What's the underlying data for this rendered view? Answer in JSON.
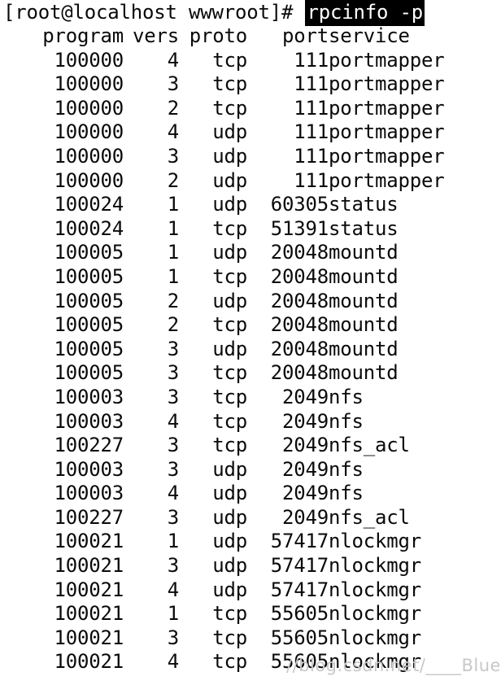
{
  "terminal": {
    "background_color": "#ffffff",
    "foreground_color": "#0a0a0a",
    "highlight_background": "#000000",
    "highlight_foreground": "#ffffff"
  },
  "prompt": {
    "text": "[root@localhost wwwroot]# ",
    "command": "rpcinfo -p"
  },
  "table": {
    "headers": {
      "program": "program",
      "vers": "vers",
      "proto": "proto",
      "port": "port",
      "service": "service"
    },
    "rows": [
      {
        "program": "100000",
        "vers": "4",
        "proto": "tcp",
        "port": "111",
        "service": "portmapper"
      },
      {
        "program": "100000",
        "vers": "3",
        "proto": "tcp",
        "port": "111",
        "service": "portmapper"
      },
      {
        "program": "100000",
        "vers": "2",
        "proto": "tcp",
        "port": "111",
        "service": "portmapper"
      },
      {
        "program": "100000",
        "vers": "4",
        "proto": "udp",
        "port": "111",
        "service": "portmapper"
      },
      {
        "program": "100000",
        "vers": "3",
        "proto": "udp",
        "port": "111",
        "service": "portmapper"
      },
      {
        "program": "100000",
        "vers": "2",
        "proto": "udp",
        "port": "111",
        "service": "portmapper"
      },
      {
        "program": "100024",
        "vers": "1",
        "proto": "udp",
        "port": "60305",
        "service": "status"
      },
      {
        "program": "100024",
        "vers": "1",
        "proto": "tcp",
        "port": "51391",
        "service": "status"
      },
      {
        "program": "100005",
        "vers": "1",
        "proto": "udp",
        "port": "20048",
        "service": "mountd"
      },
      {
        "program": "100005",
        "vers": "1",
        "proto": "tcp",
        "port": "20048",
        "service": "mountd"
      },
      {
        "program": "100005",
        "vers": "2",
        "proto": "udp",
        "port": "20048",
        "service": "mountd"
      },
      {
        "program": "100005",
        "vers": "2",
        "proto": "tcp",
        "port": "20048",
        "service": "mountd"
      },
      {
        "program": "100005",
        "vers": "3",
        "proto": "udp",
        "port": "20048",
        "service": "mountd"
      },
      {
        "program": "100005",
        "vers": "3",
        "proto": "tcp",
        "port": "20048",
        "service": "mountd"
      },
      {
        "program": "100003",
        "vers": "3",
        "proto": "tcp",
        "port": "2049",
        "service": "nfs"
      },
      {
        "program": "100003",
        "vers": "4",
        "proto": "tcp",
        "port": "2049",
        "service": "nfs"
      },
      {
        "program": "100227",
        "vers": "3",
        "proto": "tcp",
        "port": "2049",
        "service": "nfs_acl"
      },
      {
        "program": "100003",
        "vers": "3",
        "proto": "udp",
        "port": "2049",
        "service": "nfs"
      },
      {
        "program": "100003",
        "vers": "4",
        "proto": "udp",
        "port": "2049",
        "service": "nfs"
      },
      {
        "program": "100227",
        "vers": "3",
        "proto": "udp",
        "port": "2049",
        "service": "nfs_acl"
      },
      {
        "program": "100021",
        "vers": "1",
        "proto": "udp",
        "port": "57417",
        "service": "nlockmgr"
      },
      {
        "program": "100021",
        "vers": "3",
        "proto": "udp",
        "port": "57417",
        "service": "nlockmgr"
      },
      {
        "program": "100021",
        "vers": "4",
        "proto": "udp",
        "port": "57417",
        "service": "nlockmgr"
      },
      {
        "program": "100021",
        "vers": "1",
        "proto": "tcp",
        "port": "55605",
        "service": "nlockmgr"
      },
      {
        "program": "100021",
        "vers": "3",
        "proto": "tcp",
        "port": "55605",
        "service": "nlockmgr"
      },
      {
        "program": "100021",
        "vers": "4",
        "proto": "tcp",
        "port": "55605",
        "service": "nlockmgr"
      }
    ]
  },
  "watermark": {
    "text": "//blog.csdn.net/____Blue"
  }
}
